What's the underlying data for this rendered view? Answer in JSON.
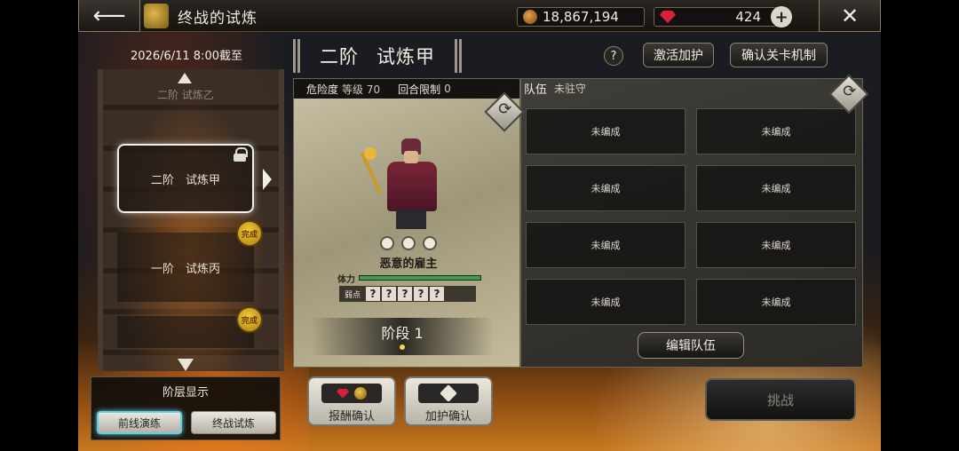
{
  "header": {
    "title": "终战的试炼",
    "gold": "18,867,194",
    "gems": "424"
  },
  "tower": {
    "deadline": "2026/6/11 8:00截至",
    "floors": [
      {
        "label": "二阶 试炼乙",
        "state": "partial"
      },
      {
        "label": "二阶　试炼甲",
        "state": "selected-locked"
      },
      {
        "label": "一阶　试炼丙",
        "state": "normal"
      }
    ],
    "seal_text": "完成",
    "layer_display": "阶层显示",
    "tab_front": "前线演练",
    "tab_final": "终战试炼"
  },
  "trial": {
    "title_rank": "二阶",
    "title_name": "试炼甲",
    "help": "?",
    "btn_guard": "激活加护",
    "btn_mechanic": "确认关卡机制"
  },
  "enemy": {
    "danger_label": "危险度",
    "level": "等级 70",
    "turn_label": "回合限制",
    "turn_value": "0",
    "name": "恶意的雇主",
    "hp_label": "体力",
    "hp_fraction": 1.0,
    "weak_label": "弱点",
    "weak_slots": [
      "?",
      "?",
      "?",
      "?",
      "?"
    ],
    "stage_label": "阶段 1"
  },
  "team": {
    "label": "队伍",
    "status": "未驻守",
    "slots": [
      "未编成",
      "未编成",
      "未编成",
      "未编成",
      "未编成",
      "未编成",
      "未编成",
      "未编成"
    ],
    "edit_btn": "编辑队伍"
  },
  "footer": {
    "reward_btn": "报酬确认",
    "guard_btn": "加护确认",
    "challenge_btn": "挑战"
  }
}
